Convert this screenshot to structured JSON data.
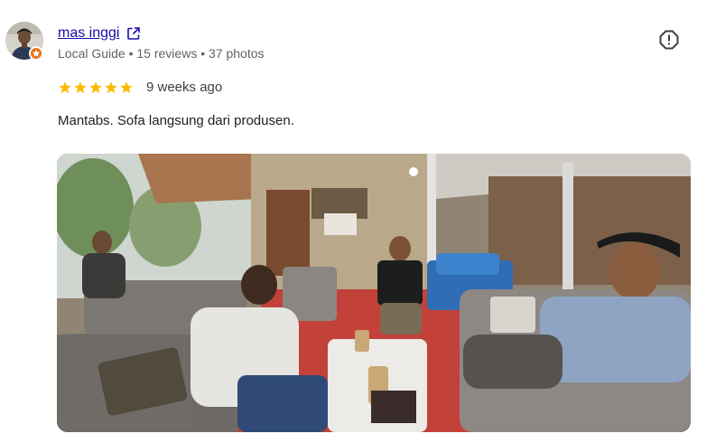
{
  "review": {
    "author": {
      "name": "mas inggi",
      "meta": "Local Guide • 15 reviews • 37 photos",
      "avatar_icon": "person-photo-avatar",
      "badge_icon": "local-guide-badge-icon",
      "badge_color": "#e8711a"
    },
    "rating": {
      "stars": 5,
      "max": 5,
      "star_color": "#fbbc04",
      "time": "9 weeks ago"
    },
    "text": "Mantabs. Sofa langsung dari produsen.",
    "photo": {
      "scene": "sofa-showroom-photo"
    },
    "actions": {
      "open_profile_icon": "external-link-icon",
      "report_icon": "report-icon"
    },
    "colors": {
      "link": "#1a0dab",
      "meta": "#5f6368"
    }
  }
}
